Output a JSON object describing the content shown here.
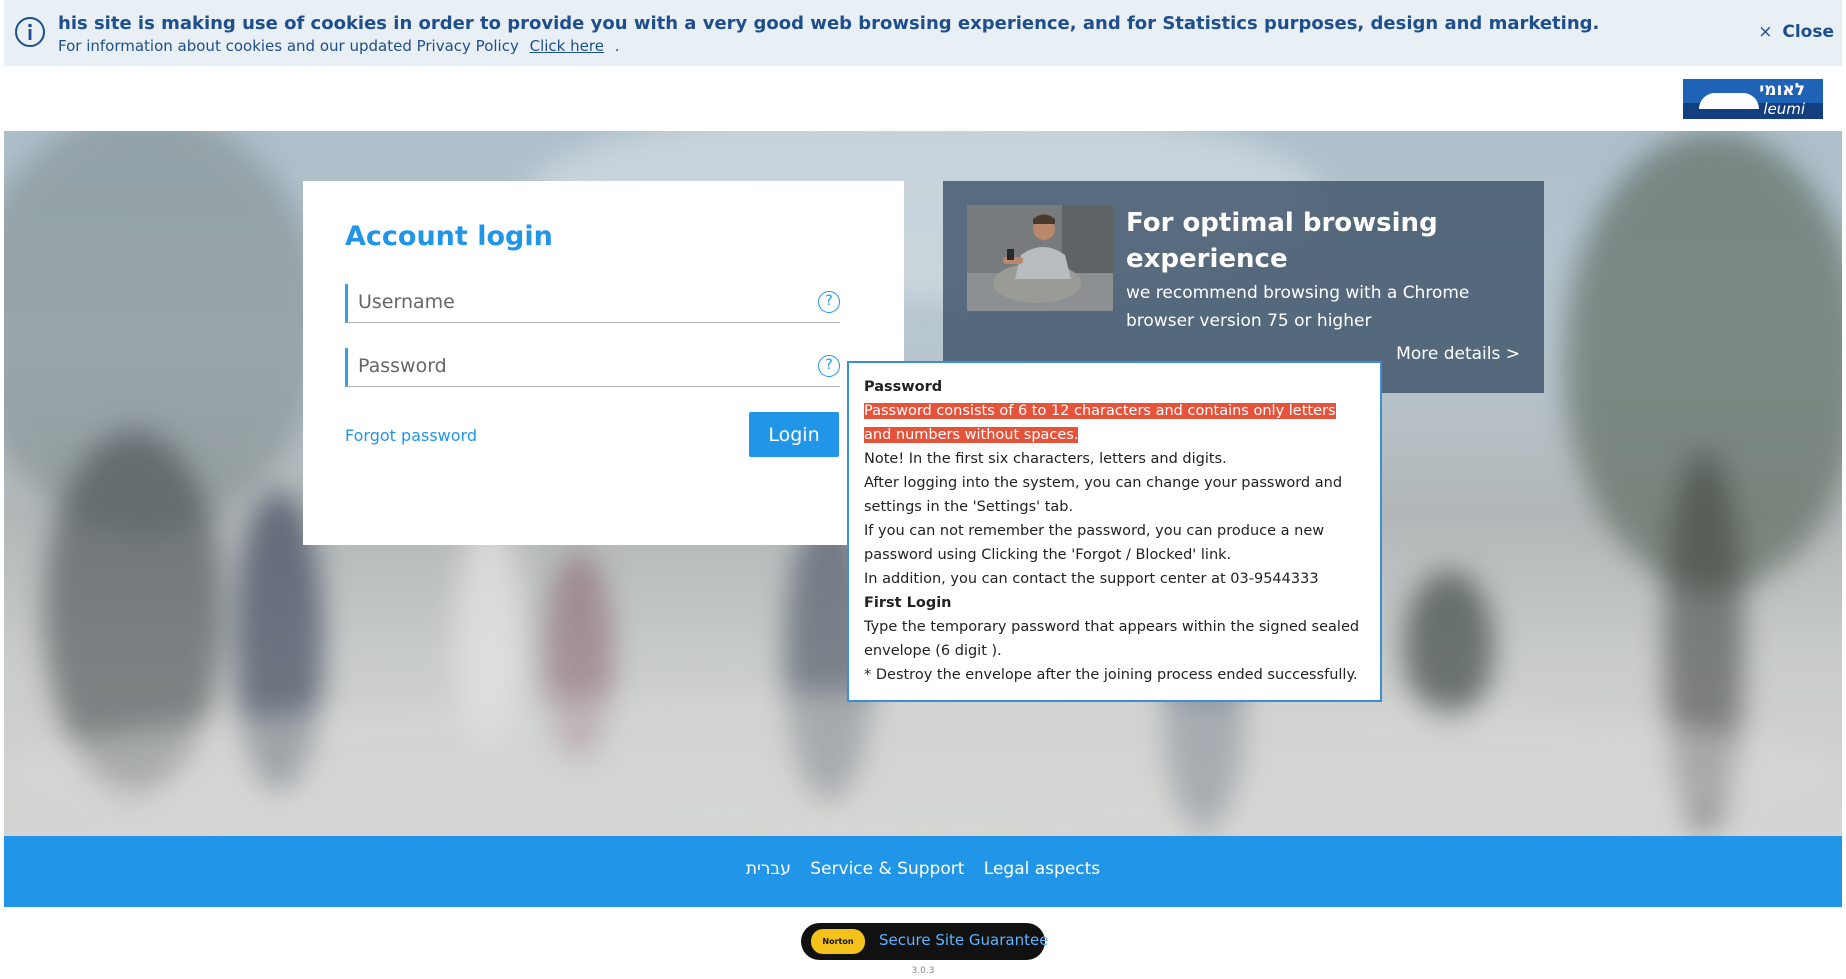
{
  "cookie_banner": {
    "message": "his site is making use of cookies in order to provide you with a very good web browsing experience, and for Statistics purposes, design and marketing.",
    "info_text": "For information about cookies and our updated Privacy Policy",
    "link_text": "Click here",
    "trailing": ".",
    "close_label": "Close",
    "close_glyph": "×",
    "info_icon": "info-icon"
  },
  "logo": {
    "hebrew": "לאומי",
    "latin": "leumi"
  },
  "login": {
    "title": "Account login",
    "username_placeholder": "Username",
    "password_placeholder": "Password",
    "help_glyph": "?",
    "forgot_label": "Forgot password",
    "login_label": "Login"
  },
  "promo": {
    "title": "For optimal browsing experience",
    "text": "we recommend browsing with a Chrome browser version 75 or higher",
    "more_label": "More details >"
  },
  "tooltip": {
    "heading": "Password",
    "highlighted": "Password consists of 6 to 12 characters and contains only letters and numbers without spaces.",
    "line1": "Note! In the first six characters, letters and digits.",
    "line2": "After logging into the system, you can change your password and settings in the 'Settings' tab.",
    "line3": "If you can not remember the password, you can produce a new password using Clicking the 'Forgot / Blocked' link.",
    "line4": "In addition, you can contact the support center at 03-9544333",
    "heading2": "First Login",
    "line5": "Type the temporary password that appears within the signed sealed envelope (6 digit ).",
    "line6": "* Destroy the envelope after the joining process ended successfully."
  },
  "footer": {
    "links": [
      "עברית",
      "Service & Support",
      "Legal aspects"
    ],
    "norton_badge": "Norton",
    "norton_text": "Secure Site Guarantee",
    "version": "3.0.3"
  },
  "colors": {
    "accent": "#2196e8",
    "banner_text": "#1e4f8c",
    "highlight": "#e5533b"
  }
}
